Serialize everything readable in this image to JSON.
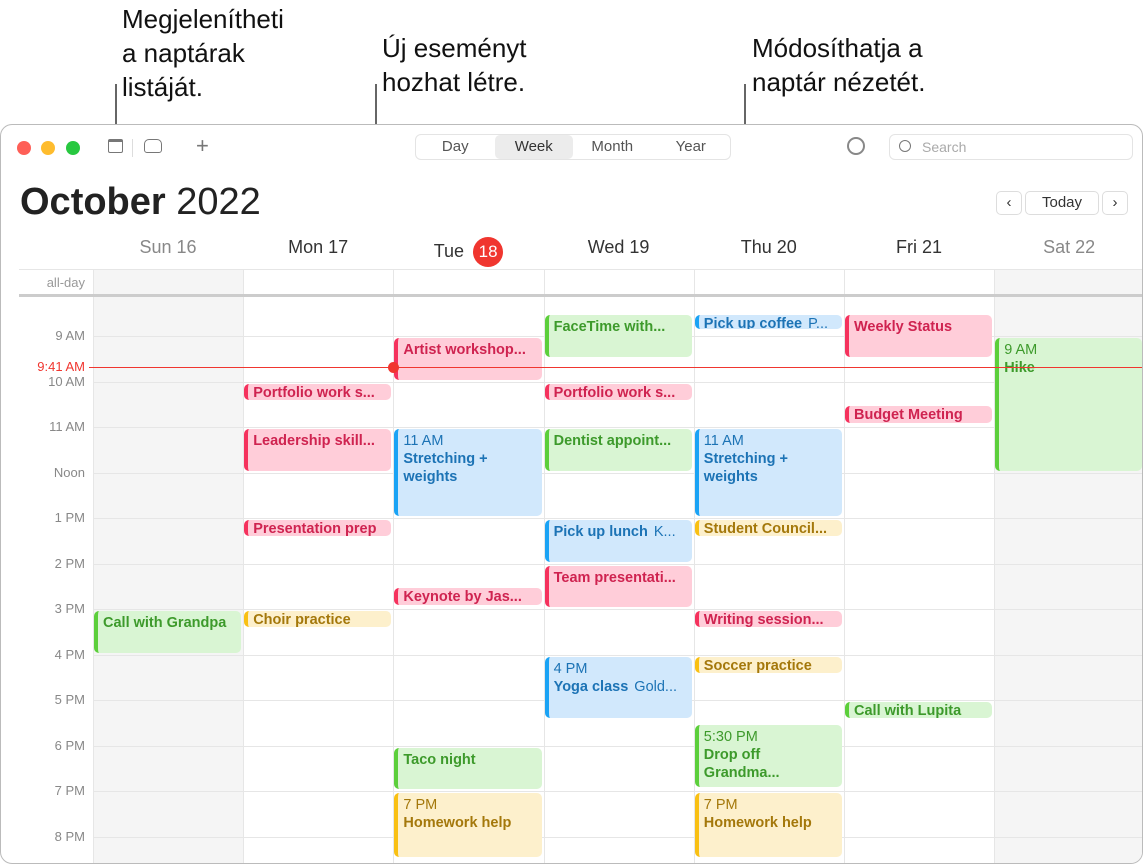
{
  "callouts": {
    "left": [
      "Megjelenítheti",
      "a naptárak",
      "listáját."
    ],
    "middle": [
      "Új eseményt",
      "hozhat létre."
    ],
    "right": [
      "Módosíthatja a",
      "naptár nézetét."
    ]
  },
  "toolbar": {
    "views": [
      "Day",
      "Week",
      "Month",
      "Year"
    ],
    "active_view": "Week",
    "search_placeholder": "Search",
    "icons": [
      "calendar-list-icon",
      "inbox-icon",
      "plus-icon",
      "airdrop-icon",
      "search-icon"
    ]
  },
  "header": {
    "month": "October",
    "year": "2022",
    "today_label": "Today"
  },
  "days": [
    {
      "label": "Sun 16",
      "weekend": true
    },
    {
      "label": "Mon 17"
    },
    {
      "label": "Tue",
      "num": "18",
      "today": true
    },
    {
      "label": "Wed 19"
    },
    {
      "label": "Thu 20"
    },
    {
      "label": "Fri 21"
    },
    {
      "label": "Sat 22",
      "weekend": true
    }
  ],
  "all_day_label": "all-day",
  "hours": [
    "9 AM",
    "10 AM",
    "11 AM",
    "Noon",
    "1 PM",
    "2 PM",
    "3 PM",
    "4 PM",
    "5 PM",
    "6 PM",
    "7 PM",
    "8 PM"
  ],
  "current_time": {
    "label": "9:41 AM",
    "hour": 9.683
  },
  "colors": {
    "red": {
      "bg": "#ffcdd9",
      "fg": "#cf2350",
      "bar": "#f5325d"
    },
    "green": {
      "bg": "#d9f5d3",
      "fg": "#3d9a2b",
      "bar": "#5ccf3b"
    },
    "blue": {
      "bg": "#d1e8fc",
      "fg": "#1c73b5",
      "bar": "#1aa3f5"
    },
    "yellow": {
      "bg": "#fdf0cc",
      "fg": "#a4780b",
      "bar": "#f9c013"
    }
  },
  "events": [
    {
      "day": 2,
      "start": 9,
      "end": 10,
      "title": "Artist workshop...",
      "color": "red"
    },
    {
      "day": 3,
      "start": 8.5,
      "end": 9.5,
      "title": "FaceTime with...",
      "color": "green"
    },
    {
      "day": 4,
      "start": 8.5,
      "end": 8.9,
      "title": "Pick up coffee",
      "location": "P...",
      "color": "blue"
    },
    {
      "day": 5,
      "start": 8.5,
      "end": 9.5,
      "title": "Weekly Status",
      "color": "red"
    },
    {
      "day": 6,
      "start": 9,
      "end": 12,
      "time": "9 AM",
      "title": "Hike",
      "color": "green"
    },
    {
      "day": 1,
      "start": 10,
      "end": 10.45,
      "title": "Portfolio work s...",
      "color": "red"
    },
    {
      "day": 3,
      "start": 10,
      "end": 10.45,
      "title": "Portfolio work s...",
      "color": "red"
    },
    {
      "day": 5,
      "start": 10.5,
      "end": 10.95,
      "title": "Budget Meeting",
      "color": "red"
    },
    {
      "day": 1,
      "start": 11,
      "end": 12,
      "title": "Leadership skill...",
      "color": "red"
    },
    {
      "day": 2,
      "start": 11,
      "end": 13,
      "time": "11 AM",
      "title": "Stretching + weights",
      "color": "blue",
      "wrap": true
    },
    {
      "day": 3,
      "start": 11,
      "end": 12,
      "title": "Dentist appoint...",
      "color": "green"
    },
    {
      "day": 4,
      "start": 11,
      "end": 13,
      "time": "11 AM",
      "title": "Stretching + weights",
      "color": "blue",
      "wrap": true
    },
    {
      "day": 1,
      "start": 13,
      "end": 13.45,
      "title": "Presentation prep",
      "color": "red"
    },
    {
      "day": 3,
      "start": 13,
      "end": 14,
      "title": "Pick up lunch",
      "location": "K...",
      "color": "blue"
    },
    {
      "day": 4,
      "start": 13,
      "end": 13.45,
      "title": "Student Council...",
      "color": "yellow"
    },
    {
      "day": 3,
      "start": 14,
      "end": 15,
      "title": "Team presentati...",
      "color": "red"
    },
    {
      "day": 2,
      "start": 14.5,
      "end": 14.95,
      "title": "Keynote by Jas...",
      "color": "red"
    },
    {
      "day": 0,
      "start": 15,
      "end": 16,
      "title": "Call with Grandpa",
      "color": "green"
    },
    {
      "day": 1,
      "start": 15,
      "end": 15.45,
      "title": "Choir practice",
      "color": "yellow"
    },
    {
      "day": 4,
      "start": 15,
      "end": 15.45,
      "title": "Writing session...",
      "color": "red"
    },
    {
      "day": 3,
      "start": 16,
      "end": 17.45,
      "time": "4 PM",
      "title": "Yoga class",
      "location": "Gold...",
      "color": "blue"
    },
    {
      "day": 4,
      "start": 16,
      "end": 16.45,
      "title": "Soccer practice",
      "color": "yellow"
    },
    {
      "day": 5,
      "start": 17,
      "end": 17.45,
      "title": "Call with Lupita",
      "color": "green"
    },
    {
      "day": 4,
      "start": 17.5,
      "end": 18.95,
      "time": "5:30 PM",
      "title": "Drop off Grandma...",
      "color": "green",
      "wrap": true
    },
    {
      "day": 2,
      "start": 18,
      "end": 19,
      "title": "Taco night",
      "color": "green"
    },
    {
      "day": 2,
      "start": 19,
      "end": 20.5,
      "time": "7 PM",
      "title": "Homework help",
      "color": "yellow"
    },
    {
      "day": 4,
      "start": 19,
      "end": 20.5,
      "time": "7 PM",
      "title": "Homework help",
      "color": "yellow"
    }
  ]
}
